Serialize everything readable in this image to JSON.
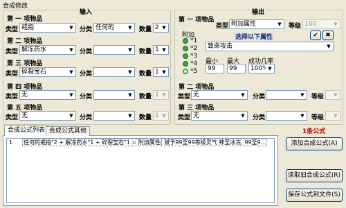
{
  "window": {
    "title": "合成修改"
  },
  "input_group": {
    "legend": "输入",
    "items": [
      {
        "label": "第 一 项物品",
        "type_label": "类型",
        "type_value": "戒指",
        "cat_label": "分类",
        "cat_value": "任何的",
        "qty_label": "数量",
        "qty_value": "2",
        "enabled": true
      },
      {
        "label": "第 二 项物品",
        "type_label": "类型",
        "type_value": "解冻药水",
        "cat_label": "分类",
        "cat_value": "",
        "qty_label": "数量",
        "qty_value": "1",
        "enabled": true
      },
      {
        "label": "第 三 项物品",
        "type_label": "类型",
        "type_value": "碎裂宝石",
        "cat_label": "分类",
        "cat_value": "",
        "qty_label": "数量",
        "qty_value": "1",
        "enabled": true
      },
      {
        "label": "第 四 项物品",
        "type_label": "类型",
        "type_value": "无",
        "cat_label": "分类",
        "cat_value": "",
        "qty_label": "数量",
        "qty_value": "1",
        "enabled": false
      },
      {
        "label": "第 五 项物品",
        "type_label": "类型",
        "type_value": "无",
        "cat_label": "分类",
        "cat_value": "",
        "qty_label": "数量",
        "qty_value": "1",
        "enabled": false
      }
    ]
  },
  "output_group": {
    "legend": "输出",
    "first": {
      "label": "第 一 项物品",
      "type_label": "类型",
      "type_value": "附加属性",
      "level_label": "等级",
      "level_value": "100"
    },
    "attach": {
      "label": "附加",
      "radios": [
        "*1",
        "*2",
        "*3",
        "*4",
        "*5"
      ],
      "selected": 4,
      "select_title": "选择以下属性",
      "attribute_value": "致命攻击",
      "min_label": "最小",
      "max_label": "最大",
      "rate_label": "成功几率",
      "min_value": "99",
      "max_value": "99",
      "rate_value": "100%"
    },
    "second": {
      "label": "第 二 项物品",
      "type_label": "类型",
      "type_value": "无",
      "cat_label": "分类",
      "cat_value": "",
      "level_label": "等级",
      "level_value": ""
    },
    "third": {
      "label": "第 三 项物品",
      "type_label": "类型",
      "type_value": "无",
      "cat_label": "分类",
      "cat_value": "",
      "level_label": "等级",
      "level_value": ""
    }
  },
  "formula_count": "1条公式",
  "tabs": [
    "合成公式列表",
    "合成公式其他"
  ],
  "formulas": [
    {
      "index": "1",
      "text": "任何的戒指\"2 + 解冻药水\"1 + 碎裂宝石\"1 = 附加属性( 赋予99至99等级灵气 神圣冰冻, 99至9..."
    }
  ],
  "buttons": {
    "add": "添加合成公式(A)",
    "read": "读取旧合成公式(R)",
    "save": "保存公式到文件(S)"
  },
  "icons": {
    "confirm": "check-icon",
    "cancel": "x-icon",
    "dropdown": "chevron-down-icon"
  }
}
